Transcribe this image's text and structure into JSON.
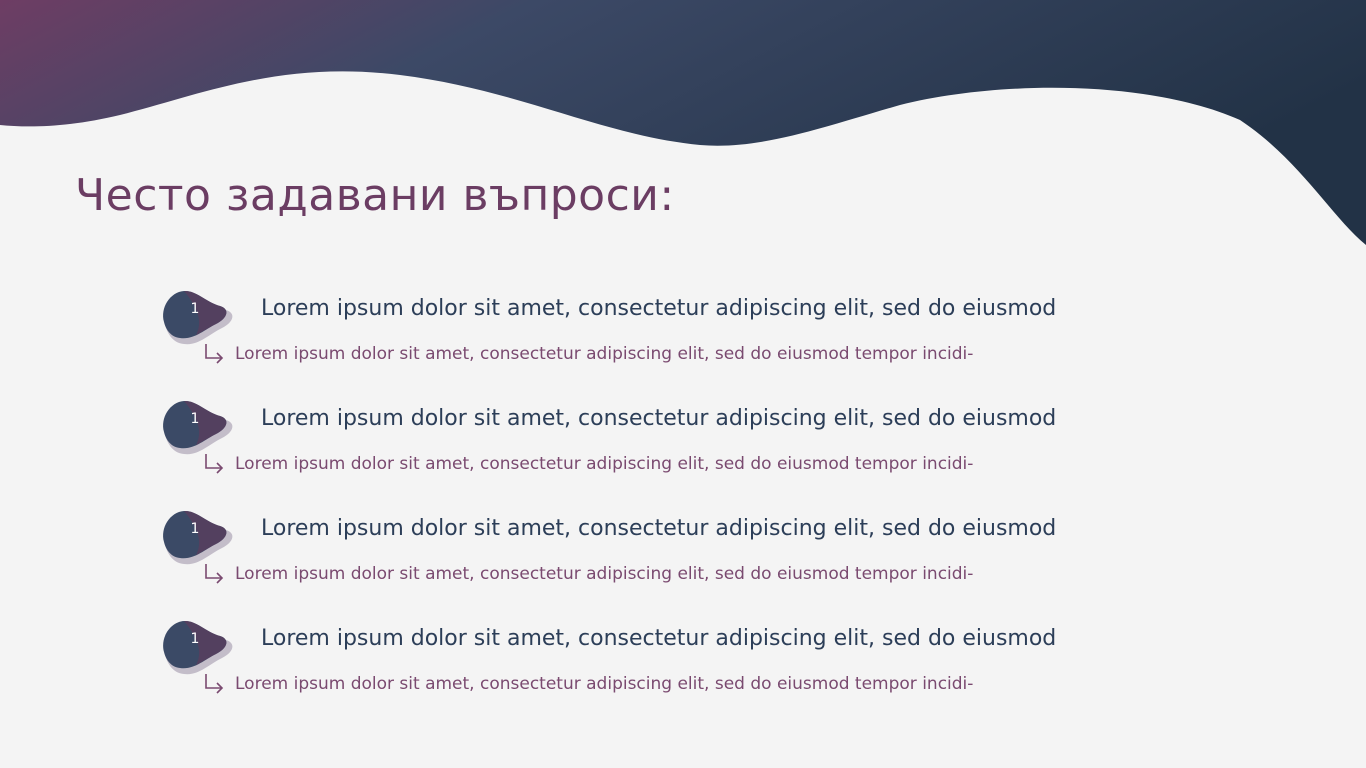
{
  "title": "Често задавани въпроси:",
  "colors": {
    "background": "#f4f4f4",
    "header_gradient_start": "#6e3d64",
    "header_gradient_mid": "#3a4a66",
    "header_gradient_end": "#223246",
    "title": "#6b3d63",
    "question": "#2c3e58",
    "answer": "#7a4a70"
  },
  "faq": [
    {
      "number": "1",
      "question": "Lorem ipsum dolor sit amet, consectetur adipiscing elit, sed do eiusmod",
      "answer": "Lorem ipsum dolor sit amet, consectetur adipiscing elit, sed do eiusmod tempor incidi-",
      "icon": "arrow-turn-right-icon"
    },
    {
      "number": "1",
      "question": "Lorem ipsum dolor sit amet, consectetur adipiscing elit, sed do eiusmod",
      "answer": "Lorem ipsum dolor sit amet, consectetur adipiscing elit, sed do eiusmod tempor incidi-",
      "icon": "arrow-turn-right-icon"
    },
    {
      "number": "1",
      "question": "Lorem ipsum dolor sit amet, consectetur adipiscing elit, sed do eiusmod",
      "answer": "Lorem ipsum dolor sit amet, consectetur adipiscing elit, sed do eiusmod tempor incidi-",
      "icon": "arrow-turn-right-icon"
    },
    {
      "number": "1",
      "question": "Lorem ipsum dolor sit amet, consectetur adipiscing elit, sed do eiusmod",
      "answer": "Lorem ipsum dolor sit amet, consectetur adipiscing elit, sed do eiusmod tempor incidi-",
      "icon": "arrow-turn-right-icon"
    }
  ]
}
